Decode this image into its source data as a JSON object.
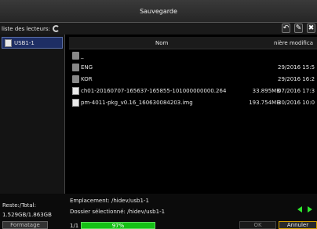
{
  "window": {
    "title": "Sauvegarde"
  },
  "drives": {
    "label": "liste des lecteurs:",
    "items": [
      {
        "label": "USB1-1"
      }
    ]
  },
  "table": {
    "headers": {
      "name": "Nom",
      "date": "nière modifica"
    },
    "rows": [
      {
        "type": "folder",
        "name": "_",
        "size": "",
        "date": ""
      },
      {
        "type": "folder",
        "name": "ENG",
        "size": "",
        "date": "29/2016 15:5"
      },
      {
        "type": "folder",
        "name": "KOR",
        "size": "",
        "date": "29/2016 16:2"
      },
      {
        "type": "file",
        "name": "ch01-20160707-165637-165855-101000000000.264",
        "size": "33.895MB",
        "date": "07/2016 17:3"
      },
      {
        "type": "file",
        "name": "pm-4011-pkg_v0.16_160630084203.img",
        "size": "193.754MB",
        "date": "30/2016 10:0"
      }
    ]
  },
  "bottom": {
    "reste_label": "Reste:/Total:",
    "reste_value": "1.529GB/1.863GB",
    "emplacement": "Emplacement: /hidev/usb1-1",
    "dossier": "Dossier sélectionné: /hidev/usb1-1",
    "format_label": "Formatage",
    "page": "1/1",
    "progress_text": "97%",
    "progress_value": 0.97,
    "ok_label": "OK",
    "cancel_label": "Annuler"
  },
  "icons": [
    "refresh-icon",
    "back-icon",
    "pen-icon",
    "close-icon",
    "usb-drive-icon",
    "folder-icon",
    "file-icon",
    "arrow-left-icon",
    "arrow-right-icon"
  ],
  "colors": {
    "accent_green": "#15c015",
    "selection_blue": "#1e2e64",
    "cancel_border": "#d4a000"
  }
}
